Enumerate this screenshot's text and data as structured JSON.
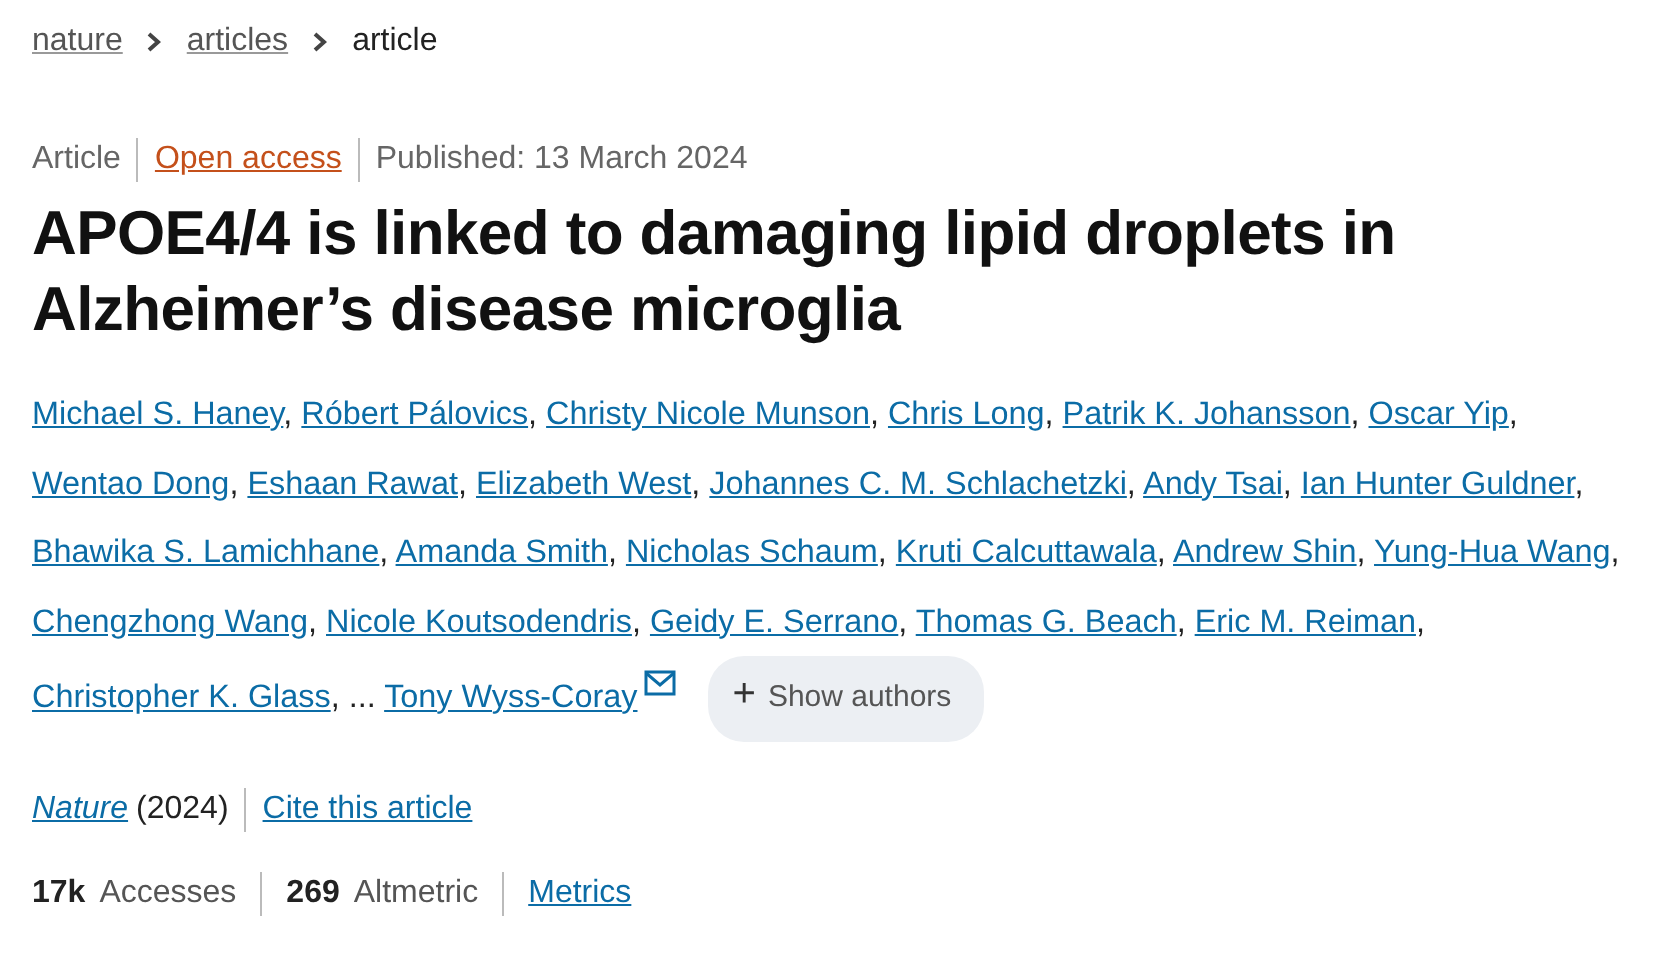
{
  "breadcrumbs": [
    {
      "label": "nature",
      "link": true
    },
    {
      "label": "articles",
      "link": true
    },
    {
      "label": "article",
      "link": false
    }
  ],
  "meta": [
    {
      "label": "Article",
      "kind": "type"
    },
    {
      "label": "Open access",
      "kind": "access"
    },
    {
      "label": "Published: 13 March 2024",
      "kind": "date"
    }
  ],
  "title": "APOE4/4 is linked to damaging lipid droplets in Alzheimer’s disease microglia",
  "authors": [
    {
      "kind": "author",
      "name": "Michael S. Haney",
      "sep": ","
    },
    {
      "kind": "author",
      "name": "Róbert Pálovics",
      "sep": ","
    },
    {
      "kind": "author",
      "name": "Christy Nicole Munson",
      "sep": ","
    },
    {
      "kind": "author",
      "name": "Chris Long",
      "sep": ","
    },
    {
      "kind": "author",
      "name": "Patrik K. Johansson",
      "sep": ","
    },
    {
      "kind": "author",
      "name": "Oscar Yip",
      "sep": ","
    },
    {
      "kind": "author",
      "name": "Wentao Dong",
      "sep": ","
    },
    {
      "kind": "author",
      "name": "Eshaan Rawat",
      "sep": ","
    },
    {
      "kind": "author",
      "name": "Elizabeth West",
      "sep": ","
    },
    {
      "kind": "author",
      "name": "Johannes C. M. Schlachetzki",
      "sep": ","
    },
    {
      "kind": "author",
      "name": "Andy Tsai",
      "sep": ","
    },
    {
      "kind": "author",
      "name": "Ian Hunter Guldner",
      "sep": ","
    },
    {
      "kind": "author",
      "name": "Bhawika S. Lamichhane",
      "sep": ","
    },
    {
      "kind": "author",
      "name": "Amanda Smith",
      "sep": ","
    },
    {
      "kind": "author",
      "name": "Nicholas Schaum",
      "sep": ","
    },
    {
      "kind": "author",
      "name": "Kruti Calcuttawala",
      "sep": ","
    },
    {
      "kind": "author",
      "name": "Andrew Shin",
      "sep": ","
    },
    {
      "kind": "author",
      "name": "Yung-Hua Wang",
      "sep": ","
    },
    {
      "kind": "author",
      "name": "Chengzhong Wang",
      "sep": ","
    },
    {
      "kind": "author",
      "name": "Nicole Koutsodendris",
      "sep": ","
    },
    {
      "kind": "author",
      "name": "Geidy E. Serrano",
      "sep": ","
    },
    {
      "kind": "author",
      "name": "Thomas G. Beach",
      "sep": ","
    },
    {
      "kind": "author",
      "name": "Eric M. Reiman",
      "sep": ","
    },
    {
      "kind": "author",
      "name": "Christopher K. Glass",
      "sep": ","
    },
    {
      "kind": "ellipsis",
      "name": "..."
    },
    {
      "kind": "author",
      "name": "Tony Wyss-Coray",
      "email": true
    }
  ],
  "show_authors": {
    "icon": "+",
    "label": "Show authors"
  },
  "citation": {
    "journal": "Nature",
    "year": "(2024)",
    "cite": "Cite this article"
  },
  "metrics": [
    {
      "kind": "count",
      "count": "17k",
      "name": "Accesses"
    },
    {
      "kind": "count",
      "count": "269",
      "name": "Altmetric"
    },
    {
      "kind": "link",
      "label": "Metrics"
    }
  ]
}
